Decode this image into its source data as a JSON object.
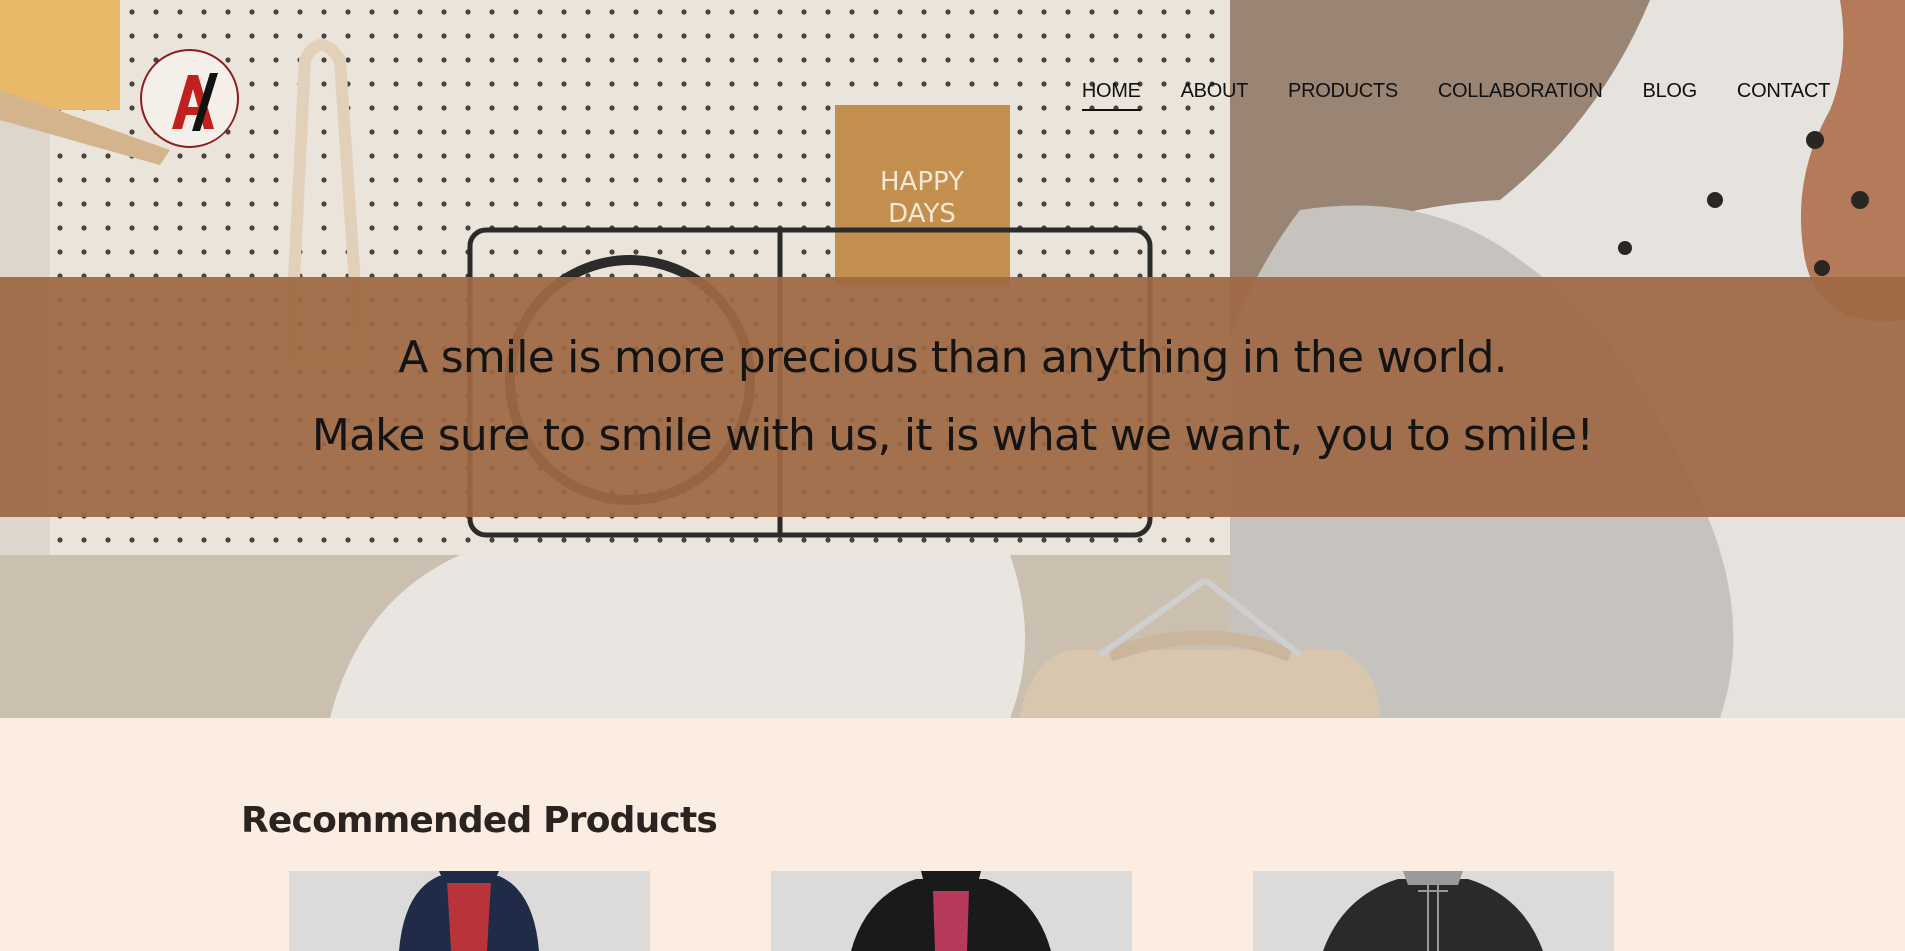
{
  "brand": {
    "logo_letters": "A/",
    "logo_colors": {
      "ring": "#8b1e1e",
      "letter": "#c0201e",
      "slash": "#111111"
    }
  },
  "nav": {
    "items": [
      {
        "label": "HOME",
        "active": true
      },
      {
        "label": "ABOUT",
        "active": false
      },
      {
        "label": "PRODUCTS",
        "active": false
      },
      {
        "label": "COLLABORATION",
        "active": false
      },
      {
        "label": "BLOG",
        "active": false
      },
      {
        "label": "CONTACT",
        "active": false
      }
    ]
  },
  "hero": {
    "line1": "A smile is more precious than anything in the world.",
    "line2": "Make sure to smile with us, it is what we want, you to smile!",
    "banner_color": "#9e6844",
    "book_text": "HAPPY DAYS"
  },
  "recommended": {
    "title": "Recommended Products",
    "products": [
      {
        "icon": "abaya-navy-red-image",
        "colors": [
          "#1f2b47",
          "#b8333a"
        ]
      },
      {
        "icon": "abaya-black-pink-image",
        "colors": [
          "#1a1a1a",
          "#b83a5a"
        ]
      },
      {
        "icon": "abaya-black-gray-image",
        "colors": [
          "#2a2a2a",
          "#9a9a9a"
        ]
      }
    ]
  },
  "colors": {
    "page_bg": "#fcede2"
  }
}
